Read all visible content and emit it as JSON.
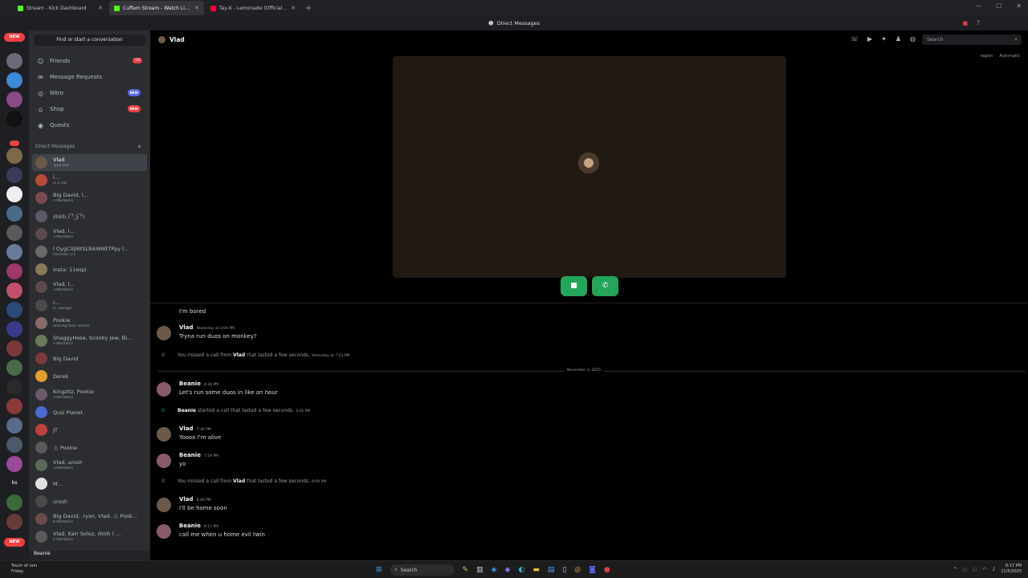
{
  "browser": {
    "tabs": [
      {
        "label": "Stream - Kick Dashboard",
        "color": "#53fc18"
      },
      {
        "label": "Cuffem Stream - Watch Live on",
        "color": "#53fc18",
        "active": true
      },
      {
        "label": "Tay-K - Lemonade (Official Aud",
        "color": "#ff0033"
      }
    ],
    "new_tab": "+",
    "controls": [
      "—",
      "☐",
      "✕"
    ]
  },
  "titlebar": {
    "title": "Direct Messages"
  },
  "rail": {
    "new_top": "NEW",
    "new_bottom": "NEW"
  },
  "sidebar": {
    "find": "Find or start a conversation",
    "nav": [
      {
        "label": "Friends",
        "badge": "18"
      },
      {
        "label": "Message Requests"
      },
      {
        "label": "Nitro",
        "tag": "NEW"
      },
      {
        "label": "Shop",
        "tag": "NEW"
      },
      {
        "label": "Quests"
      }
    ],
    "dm_header": "Direct Messages",
    "dms": [
      {
        "name": "Vlad",
        "sub": "Type shit",
        "active": true,
        "color": "#6b5a4a"
      },
      {
        "name": "l...",
        "sub": "In a call",
        "color": "#b84a3a"
      },
      {
        "name": "Big David, l...",
        "sub": "3 Members",
        "color": "#7a4a52"
      },
      {
        "name": "ıllılıllı ( ͡° ͜ʖ ͡°)",
        "sub": "",
        "color": "#5a5a6a"
      },
      {
        "name": "Vlad, l...",
        "sub": "3 Members",
        "color": "#5a4a4a"
      },
      {
        "name": "l OygCXJl6tSLlkkW6ltTPpy l...",
        "sub": "Proverbs 3:5",
        "color": "#6a6a6a"
      },
      {
        "name": "insta: 11espi",
        "sub": "",
        "color": "#8a7a5a"
      },
      {
        "name": "Vlad, l...",
        "sub": "3 Members",
        "color": "#5a4a4a"
      },
      {
        "name": "r...",
        "sub": "D. Savage",
        "color": "#4a4a4a"
      },
      {
        "name": "Pookie",
        "sub": "Sharing their screen",
        "color": "#8a6a6a"
      },
      {
        "name": "ShaggyHose, Scooby Jew, Bi...",
        "sub": "4 Members",
        "color": "#6a7a5a"
      },
      {
        "name": "Big David",
        "sub": "",
        "color": "#7a3a3a"
      },
      {
        "name": "Derek",
        "sub": "",
        "color": "#e0a030"
      },
      {
        "name": "Kingzitz, Pookie",
        "sub": "3 Members",
        "color": "#6a5a6a"
      },
      {
        "name": "Quiz Planet",
        "sub": "",
        "color": "#4a6ad0"
      },
      {
        "name": "JT",
        "sub": "",
        "color": "#c04040"
      },
      {
        "name": ":), Pookie",
        "sub": "",
        "color": "#5a5a5a"
      },
      {
        "name": "Vlad, urosh",
        "sub": "3 Members",
        "color": "#5a6a5a"
      },
      {
        "name": "M...",
        "sub": "",
        "color": "#e0e0e0"
      },
      {
        "name": "urosh",
        "sub": "",
        "color": "#4a4a4a"
      },
      {
        "name": "Big David, .ryxn, Vlad, :), Pook...",
        "sub": "8 Members",
        "color": "#6a4a4a"
      },
      {
        "name": "Vlad, Karr Solez, ıllılıllı ( ...",
        "sub": "4 Members",
        "color": "#5a5a5a"
      }
    ],
    "current_user": "Beanie"
  },
  "channel": {
    "name": "Vlad",
    "search_placeholder": "Search",
    "region_label": "region",
    "region_value": "Automatic"
  },
  "messages": {
    "top_text": "I'm bored",
    "date_divider": "November 3, 2025",
    "items": [
      {
        "type": "msg",
        "author": "Vlad",
        "time": "Yesterday at 3:04 PM",
        "text": "Tryna run duos on monkey?",
        "color": "#6b5a4a"
      },
      {
        "type": "sys",
        "pre": "You missed a call from ",
        "who": "Vlad",
        "post": " that lasted a few seconds.",
        "time": "Yesterday at 7:03 PM",
        "green": false
      },
      {
        "type": "msg",
        "author": "Beanie",
        "time": "4:34 PM",
        "text": "Let's run some duos in like an hour",
        "color": "#8a5a6a"
      },
      {
        "type": "sys",
        "pre": "",
        "who": "Beanie",
        "post": " started a call that lasted a few seconds.",
        "time": "4:45 PM",
        "green": true
      },
      {
        "type": "msg",
        "author": "Vlad",
        "time": "7:36 PM",
        "text": "Yoooo I'm alive",
        "color": "#6b5a4a"
      },
      {
        "type": "msg",
        "author": "Beanie",
        "time": "7:59 PM",
        "text": "yo",
        "color": "#8a5a6a"
      },
      {
        "type": "sys",
        "pre": "You missed a call from ",
        "who": "Vlad",
        "post": " that lasted a few seconds.",
        "time": "8:09 PM",
        "green": false
      },
      {
        "type": "msg",
        "author": "Vlad",
        "time": "8:40 PM",
        "text": "I'll be home soon",
        "color": "#6b5a4a"
      },
      {
        "type": "msg",
        "author": "Beanie",
        "time": "8:17 PM",
        "text": "call me when u home evil twin",
        "color": "#8a5a6a"
      }
    ]
  },
  "taskbar": {
    "weather_line1": "Touch of rain",
    "weather_line2": "Friday",
    "search": "Search",
    "time": "8:17 PM",
    "date": "11/5/2025"
  }
}
